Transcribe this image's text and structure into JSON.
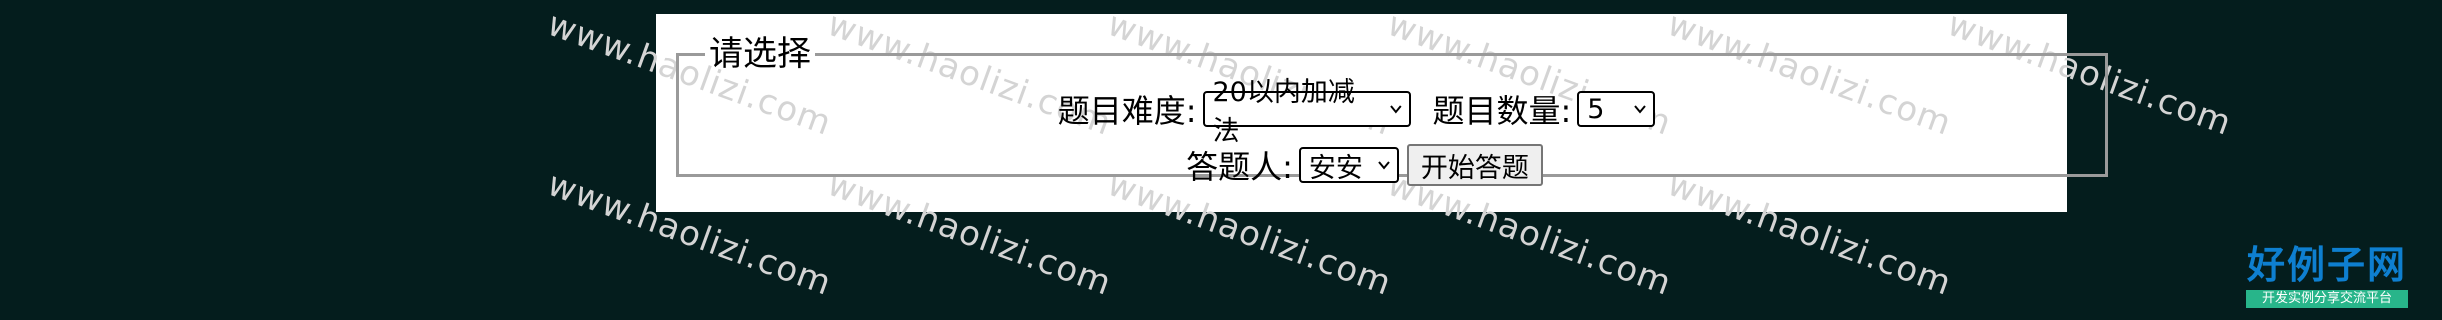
{
  "watermark": {
    "text": "www.haolizi.com"
  },
  "form": {
    "legend": "请选择",
    "difficulty_label": "题目难度:",
    "difficulty_value": "20以内加减法",
    "count_label": "题目数量:",
    "count_value": "5",
    "answerer_label": "答题人:",
    "answerer_value": "安安",
    "start_button": "开始答题"
  },
  "logo": {
    "title": "好例子网",
    "subtitle": "开发实例分享交流平台"
  },
  "colors": {
    "background": "#041d1d",
    "panel": "#ffffff",
    "logo_blue": "#0e7fd0",
    "logo_green": "#28b58a"
  }
}
